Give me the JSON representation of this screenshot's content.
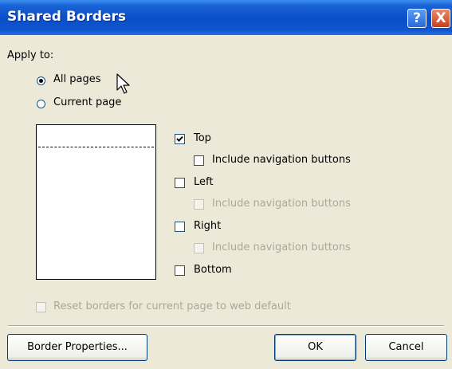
{
  "title": "Shared Borders",
  "titlebar_buttons": {
    "help": "?",
    "close": "X"
  },
  "apply_to": {
    "label": "Apply to:",
    "options": [
      {
        "label": "All pages",
        "selected": true
      },
      {
        "label": "Current page",
        "selected": false
      }
    ]
  },
  "borders": [
    {
      "label": "Top",
      "checked": true,
      "enabled": true,
      "nav": {
        "label": "Include navigation buttons",
        "checked": false,
        "enabled": true
      }
    },
    {
      "label": "Left",
      "checked": false,
      "enabled": true,
      "nav": {
        "label": "Include navigation buttons",
        "checked": false,
        "enabled": false
      }
    },
    {
      "label": "Right",
      "checked": false,
      "enabled": true,
      "nav": {
        "label": "Include navigation buttons",
        "checked": false,
        "enabled": false
      }
    },
    {
      "label": "Bottom",
      "checked": false,
      "enabled": true
    }
  ],
  "reset": {
    "label": "Reset borders for current page to web default",
    "checked": false,
    "enabled": false
  },
  "buttons": {
    "border_properties": "Border Properties...",
    "ok": "OK",
    "cancel": "Cancel"
  },
  "colors": {
    "titlebar": "#0a4fc6",
    "dialog_bg": "#ece9d8",
    "disabled_text": "#aca899"
  }
}
